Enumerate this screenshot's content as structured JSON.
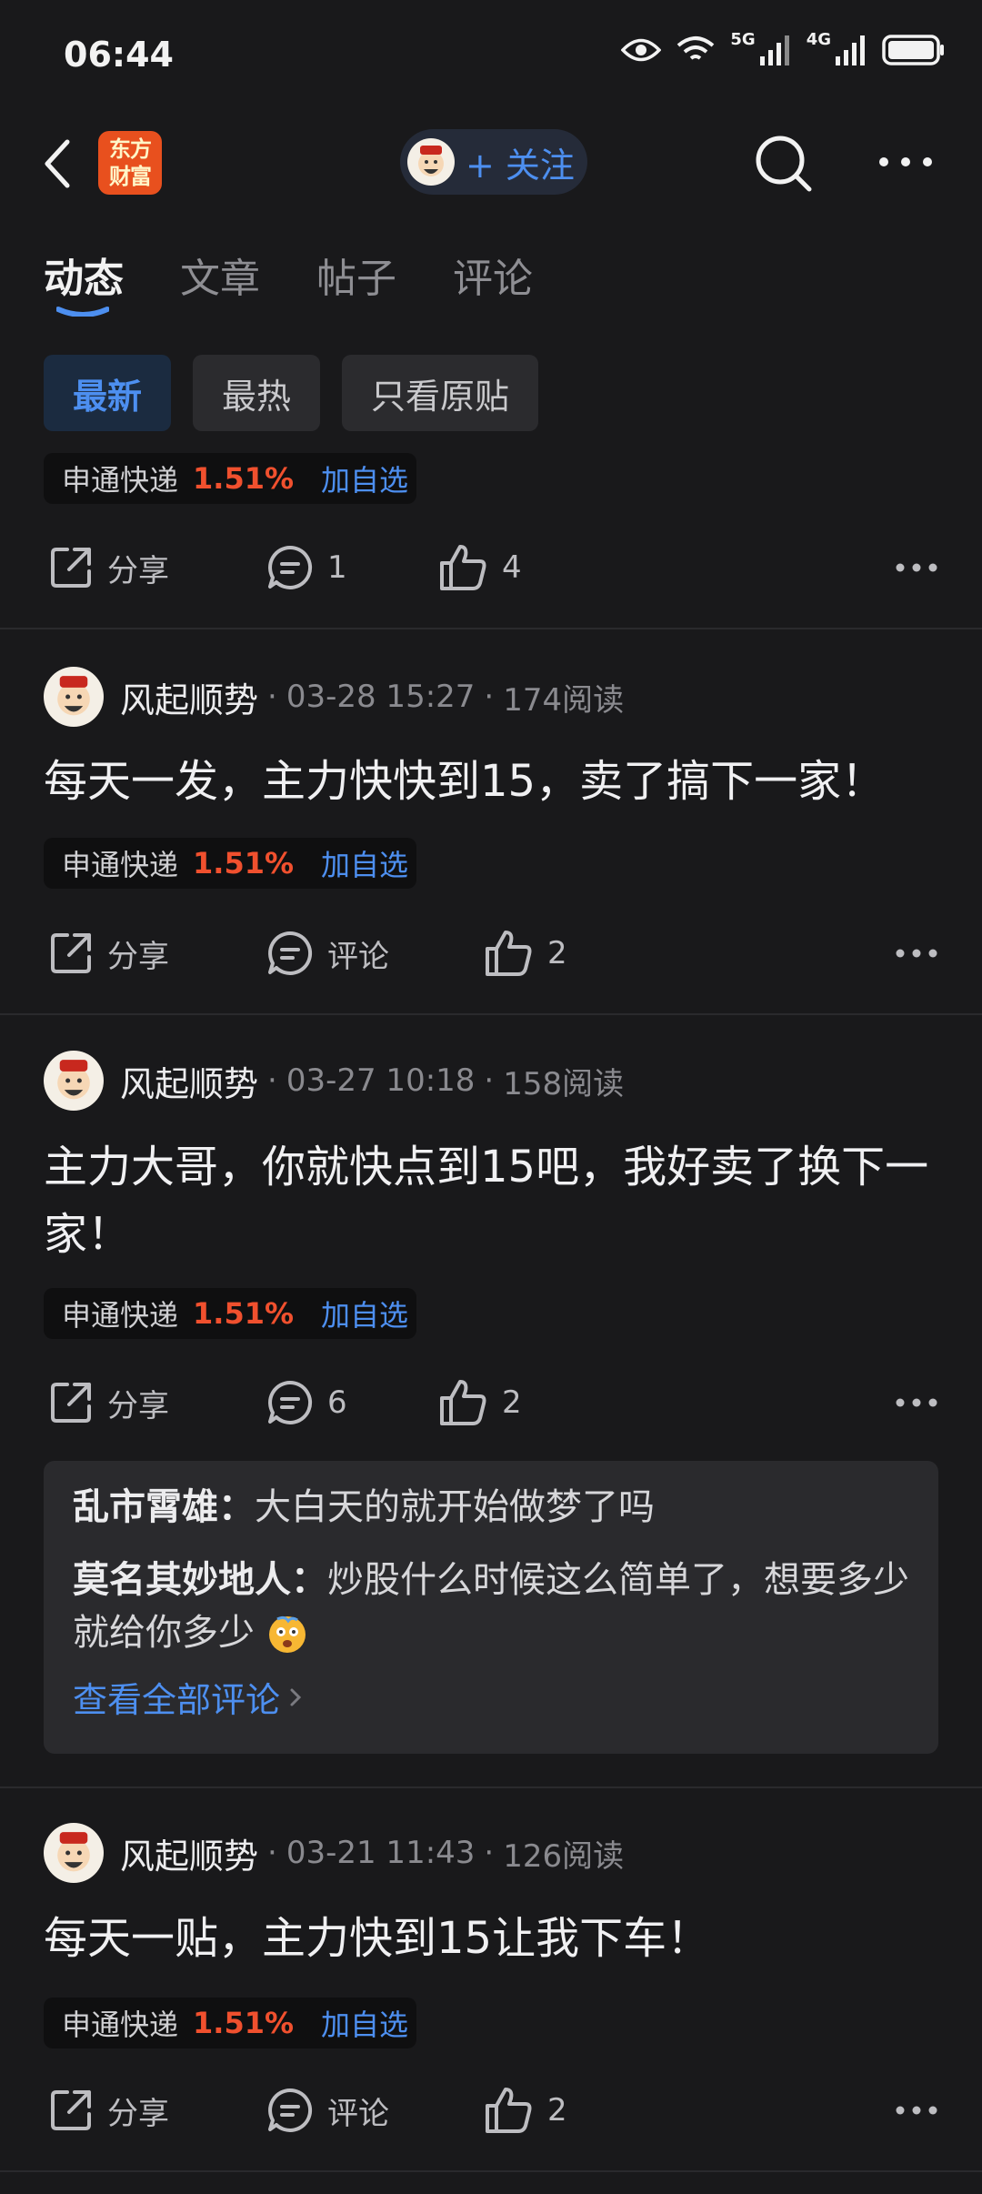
{
  "status_bar": {
    "time": "06:44",
    "network_1": "5G",
    "network_2": "4G"
  },
  "nav": {
    "app_logo_line1": "东方",
    "app_logo_line2": "财富",
    "follow_label": "+ 关注"
  },
  "tabs": [
    {
      "label": "动态",
      "active": true
    },
    {
      "label": "文章",
      "active": false
    },
    {
      "label": "帖子",
      "active": false
    },
    {
      "label": "评论",
      "active": false
    }
  ],
  "filters": [
    {
      "label": "最新",
      "active": true
    },
    {
      "label": "最热",
      "active": false
    },
    {
      "label": "只看原贴",
      "active": false
    }
  ],
  "stock_tag": {
    "name": "申通快递",
    "change": "1.51%",
    "add_label": "加自选"
  },
  "top_post": {
    "share_label": "分享",
    "comment_value": "1",
    "like_value": "4"
  },
  "posts": [
    {
      "author": "风起顺势",
      "date": "03-28 15:27",
      "reads": "174阅读",
      "text": "每天一发，主力快快到15，卖了搞下一家！",
      "share_label": "分享",
      "comment_value": "评论",
      "like_value": "2"
    },
    {
      "author": "风起顺势",
      "date": "03-27 10:18",
      "reads": "158阅读",
      "text": "主力大哥，你就快点到15吧，我好卖了换下一家！",
      "share_label": "分享",
      "comment_value": "6",
      "like_value": "2",
      "comments": [
        {
          "user": "乱市霄雄",
          "text": "大白天的就开始做梦了吗"
        },
        {
          "user": "莫名其妙地人",
          "text": "炒股什么时候这么简单了，想要多少就给你多少"
        }
      ],
      "view_all_label": "查看全部评论"
    },
    {
      "author": "风起顺势",
      "date": "03-21 11:43",
      "reads": "126阅读",
      "text": "每天一贴，主力快到15让我下车！",
      "share_label": "分享",
      "comment_value": "评论",
      "like_value": "2"
    }
  ],
  "colors": {
    "background": "#19191b",
    "accent_blue": "#4d8ff0",
    "stock_red": "#f0502e",
    "logo_orange": "#e8501e"
  }
}
